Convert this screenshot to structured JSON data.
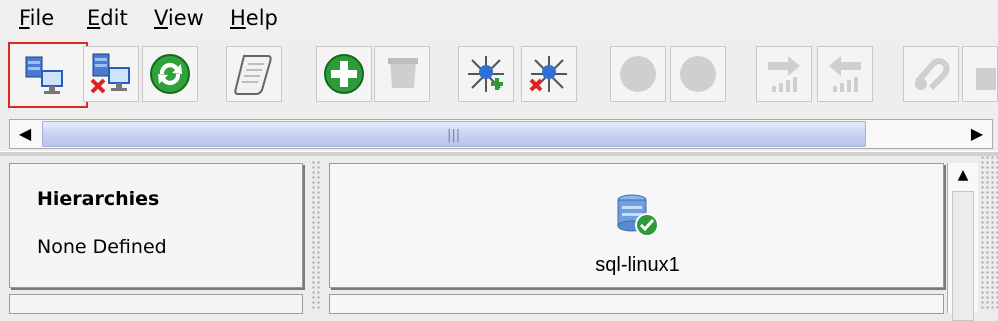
{
  "menu": {
    "items": [
      {
        "mnemonic": "F",
        "rest": "ile"
      },
      {
        "mnemonic": "E",
        "rest": "dit"
      },
      {
        "mnemonic": "V",
        "rest": "iew"
      },
      {
        "mnemonic": "H",
        "rest": "elp"
      }
    ]
  },
  "toolbar": {
    "buttons": [
      {
        "icon": "connect-server-icon",
        "state": "selected"
      },
      {
        "icon": "disconnect-server-icon",
        "state": "enabled"
      },
      {
        "icon": "refresh-icon",
        "state": "enabled"
      },
      {
        "icon": "scroll-log-icon",
        "state": "enabled"
      },
      {
        "icon": "add-plus-icon",
        "state": "enabled"
      },
      {
        "icon": "delete-icon",
        "state": "disabled"
      },
      {
        "icon": "add-resource-icon",
        "state": "enabled"
      },
      {
        "icon": "remove-resource-icon",
        "state": "enabled"
      },
      {
        "icon": "circle-icon",
        "state": "disabled"
      },
      {
        "icon": "circle-icon",
        "state": "disabled"
      },
      {
        "icon": "arrow-right-bars-icon",
        "state": "disabled"
      },
      {
        "icon": "arrow-left-bars-icon",
        "state": "disabled"
      },
      {
        "icon": "link-icon",
        "state": "disabled"
      }
    ]
  },
  "left_panel": {
    "title": "Hierarchies",
    "subtitle": "None Defined"
  },
  "center_panel": {
    "node_label": "sql-linux1",
    "node_icon": "server-ok-icon",
    "status_color": "#2e9a3a"
  },
  "colors": {
    "selection_border": "#e0281e",
    "scroll_thumb": "#c7d2f0"
  }
}
